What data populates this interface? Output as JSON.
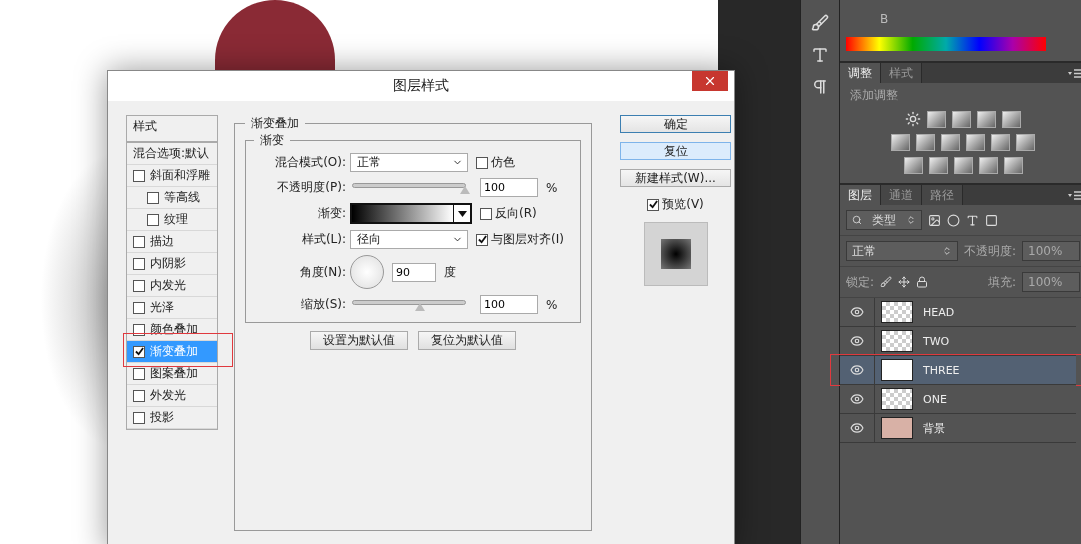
{
  "dialog": {
    "title": "图层样式",
    "styles_header": "样式",
    "blend_options": "混合选项:默认",
    "styles": [
      {
        "label": "斜面和浮雕",
        "checked": false,
        "selected": false,
        "highlighted": false,
        "children": [
          {
            "label": "等高线",
            "checked": false,
            "selected": false,
            "highlighted": false
          },
          {
            "label": "纹理",
            "checked": false,
            "selected": false,
            "highlighted": false
          }
        ]
      },
      {
        "label": "描边",
        "checked": false,
        "selected": false,
        "highlighted": false
      },
      {
        "label": "内阴影",
        "checked": false,
        "selected": false,
        "highlighted": false
      },
      {
        "label": "内发光",
        "checked": false,
        "selected": false,
        "highlighted": false
      },
      {
        "label": "光泽",
        "checked": false,
        "selected": false,
        "highlighted": false
      },
      {
        "label": "颜色叠加",
        "checked": false,
        "selected": false,
        "highlighted": false
      },
      {
        "label": "渐变叠加",
        "checked": true,
        "selected": true,
        "highlighted": true
      },
      {
        "label": "图案叠加",
        "checked": false,
        "selected": false,
        "highlighted": false
      },
      {
        "label": "外发光",
        "checked": false,
        "selected": false,
        "highlighted": false
      },
      {
        "label": "投影",
        "checked": false,
        "selected": false,
        "highlighted": false
      }
    ],
    "section_title": "渐变叠加",
    "group_title": "渐变",
    "blend_mode": {
      "label": "混合模式(O):",
      "value": "正常"
    },
    "dither": {
      "label": "仿色",
      "checked": false
    },
    "opacity": {
      "label": "不透明度(P):",
      "level": 1,
      "value": "100",
      "unit": "%"
    },
    "gradient": {
      "label": "渐变:"
    },
    "reverse": {
      "label": "反向(R)",
      "checked": false
    },
    "style": {
      "label": "样式(L):",
      "value": "径向"
    },
    "align": {
      "label": "与图层对齐(I)",
      "checked": true
    },
    "angle": {
      "label": "角度(N):",
      "value": "90",
      "unit": "度"
    },
    "scale": {
      "label": "缩放(S):",
      "level": 0.6,
      "value": "100",
      "unit": "%"
    },
    "default_buttons": [
      "设置为默认值",
      "复位为默认值"
    ],
    "side_buttons": [
      {
        "label": "确定",
        "kind": "primary"
      },
      {
        "label": "复位",
        "kind": "hover"
      },
      {
        "label": "新建样式(W)...",
        "kind": "normal"
      }
    ],
    "preview": {
      "label": "预览(V)",
      "checked": true
    }
  },
  "color_panel": {
    "channel": "B"
  },
  "adjustments": {
    "tabs": [
      {
        "label": "调整",
        "selected": true
      },
      {
        "label": "样式",
        "selected": false
      }
    ],
    "heading": "添加调整"
  },
  "layers_panel": {
    "tabs": [
      {
        "label": "图层",
        "selected": true
      },
      {
        "label": "通道",
        "selected": false
      },
      {
        "label": "路径",
        "selected": false
      }
    ],
    "filter": "类型",
    "blend_mode": "正常",
    "opacity_label": "不透明度:",
    "opacity_value": "100%",
    "lock_label": "锁定:",
    "fill_label": "填充:",
    "fill_value": "100%",
    "layers": [
      {
        "name": "HEAD",
        "visible": true,
        "selected": false,
        "highlighted": false,
        "kind": "cutout"
      },
      {
        "name": "TWO",
        "visible": true,
        "selected": false,
        "highlighted": false,
        "kind": "cutout"
      },
      {
        "name": "THREE",
        "visible": true,
        "selected": true,
        "highlighted": true,
        "kind": "fill"
      },
      {
        "name": "ONE",
        "visible": true,
        "selected": false,
        "highlighted": false,
        "kind": "cutout"
      },
      {
        "name": "背景",
        "visible": true,
        "selected": false,
        "highlighted": false,
        "kind": "background"
      }
    ]
  }
}
